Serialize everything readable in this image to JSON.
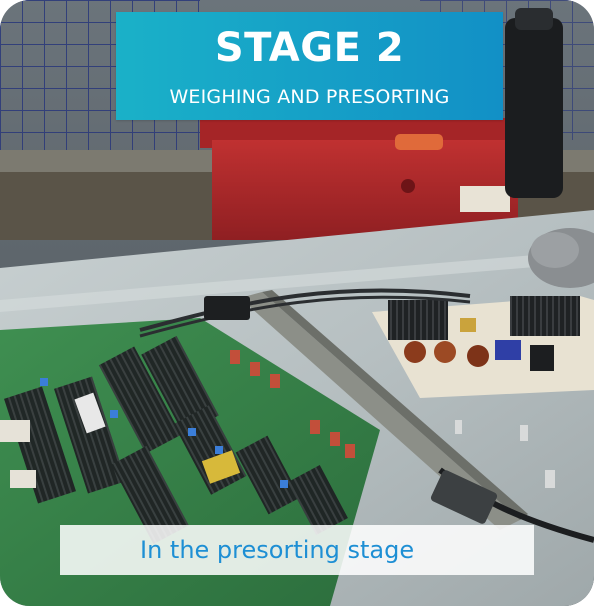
{
  "banner": {
    "title": "STAGE 2",
    "subtitle": "WEIGHING AND PRESORTING"
  },
  "caption": {
    "text": "In the presorting stage"
  },
  "colors": {
    "banner_start": "#1ab1c8",
    "banner_end": "#1290c6",
    "caption_text": "#1e8fd4",
    "caption_bg": "#ffffff"
  }
}
